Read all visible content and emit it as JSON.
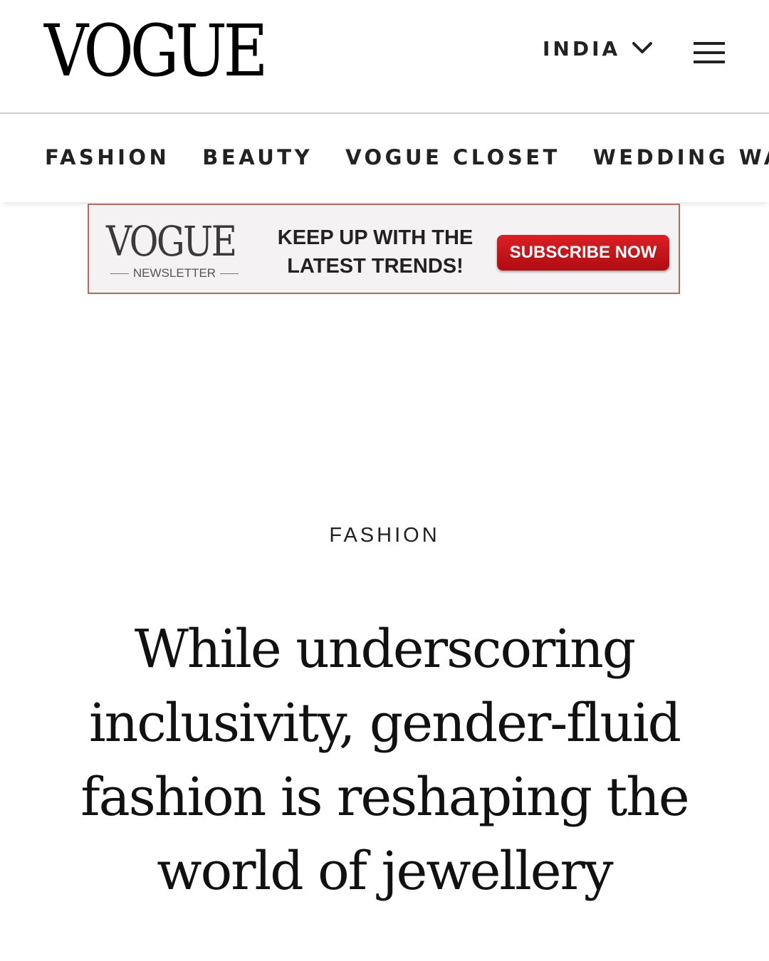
{
  "header": {
    "logo": "VOGUE",
    "edition_label": "INDIA",
    "edition_icon": "chevron-down-icon",
    "menu_icon": "hamburger-menu-icon"
  },
  "nav": {
    "items": [
      {
        "label": "FASHION"
      },
      {
        "label": "BEAUTY"
      },
      {
        "label": "VOGUE CLOSET"
      },
      {
        "label": "WEDDING WAR"
      }
    ]
  },
  "banner": {
    "logo": "VOGUE",
    "sub": "NEWSLETTER",
    "line1": "KEEP UP WITH THE",
    "line2": "LATEST TRENDS!",
    "button_label": "SUBSCRIBE NOW",
    "button_color": "#c8141a",
    "border_color": "#b7695a"
  },
  "article": {
    "category": "FASHION",
    "headline_line1": "While underscoring",
    "headline_line2": "inclusivity, gender-fluid",
    "headline_line3": "fashion is reshaping the",
    "headline_line4": "world of jewellery"
  }
}
